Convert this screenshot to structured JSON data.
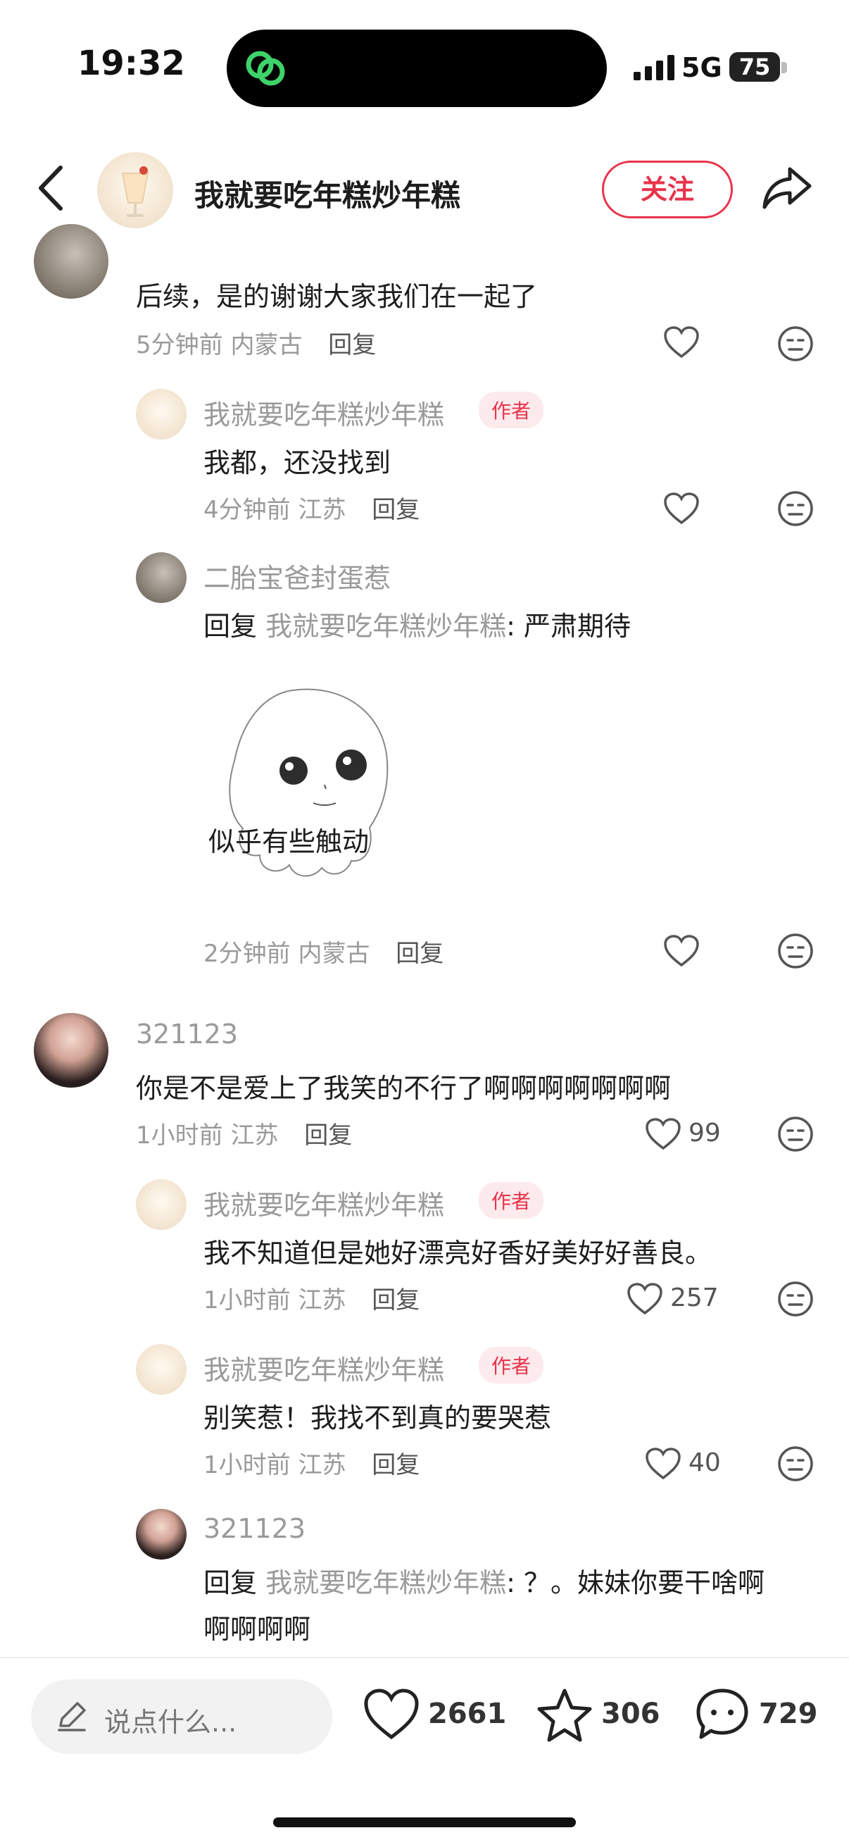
{
  "status_bar": {
    "time": "19:32",
    "network": "5G",
    "battery": "75"
  },
  "header": {
    "title": "我就要吃年糕炒年糕",
    "follow_label": "关注"
  },
  "comments": {
    "c1": {
      "text": "后续，是的谢谢大家我们在一起了",
      "time": "5分钟前",
      "location": "内蒙古",
      "reply_label": "回复"
    },
    "r1": {
      "user": "我就要吃年糕炒年糕",
      "author_tag": "作者",
      "text": "我都，还没找到",
      "time": "4分钟前",
      "location": "江苏",
      "reply_label": "回复"
    },
    "r2": {
      "user": "二胎宝爸封蛋惹",
      "reply_prefix": "回复",
      "reply_to": "我就要吃年糕炒年糕",
      "text": ": 严肃期待",
      "sticker_caption": "似乎有些触动",
      "time": "2分钟前",
      "location": "内蒙古",
      "reply_label": "回复"
    },
    "c2": {
      "user": "321123",
      "text": "你是不是爱上了我笑的不行了啊啊啊啊啊啊啊",
      "time": "1小时前",
      "location": "江苏",
      "reply_label": "回复",
      "likes": "99"
    },
    "r3": {
      "user": "我就要吃年糕炒年糕",
      "author_tag": "作者",
      "text": "我不知道但是她好漂亮好香好美好好善良。",
      "time": "1小时前",
      "location": "江苏",
      "reply_label": "回复",
      "likes": "257"
    },
    "r4": {
      "user": "我就要吃年糕炒年糕",
      "author_tag": "作者",
      "text": "别笑惹！我找不到真的要哭惹",
      "time": "1小时前",
      "location": "江苏",
      "reply_label": "回复",
      "likes": "40"
    },
    "r5": {
      "user": "321123",
      "reply_prefix": "回复",
      "reply_to": "我就要吃年糕炒年糕",
      "text_line1": ": ？。妹妹你要干啥啊",
      "text_line2": "啊啊啊啊"
    }
  },
  "bottom_bar": {
    "input_placeholder": "说点什么...",
    "likes": "2661",
    "stars": "306",
    "comments": "729"
  },
  "colors": {
    "accent": "#e8334b",
    "muted": "#9a9a9a"
  }
}
